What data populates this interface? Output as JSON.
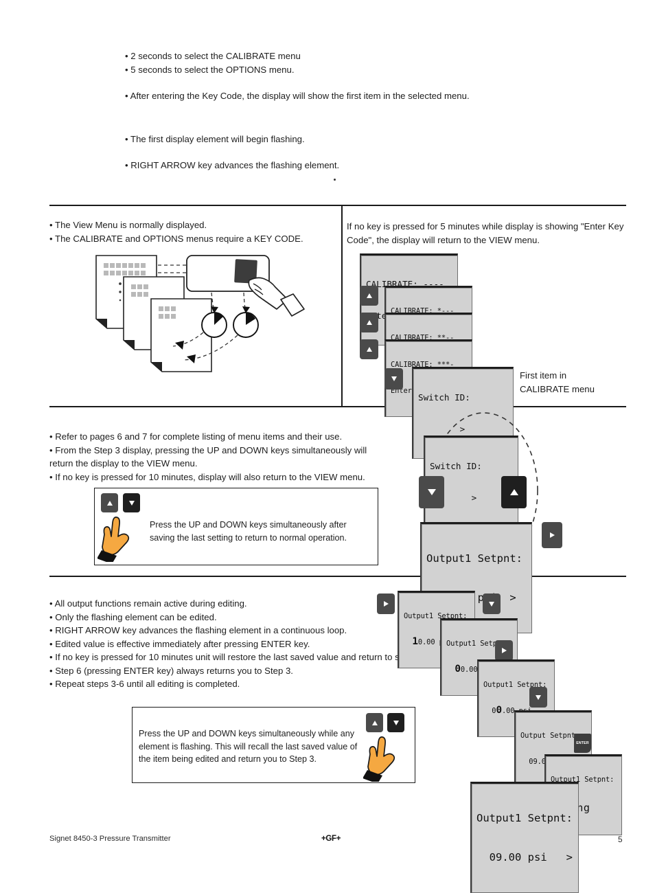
{
  "document": {
    "footer_left": "Signet 8450-3 Pressure Transmitter",
    "footer_brand": "+GF+",
    "page_number": "5"
  },
  "top_notes": {
    "group_a": [
      "2 seconds to select the CALIBRATE menu",
      "5 seconds to select the OPTIONS menu."
    ],
    "group_b": [
      "After entering the Key Code, the display will show the first item in the selected menu."
    ],
    "group_c": [
      "The first display element will begin flashing."
    ],
    "group_d": [
      "RIGHT ARROW key advances the flashing element."
    ]
  },
  "panel1": {
    "left_bullets": [
      "The View Menu is normally displayed.",
      "The CALIBRATE and OPTIONS menus require a KEY CODE."
    ],
    "right_text": "If no key is pressed for 5 minutes while display is showing \"Enter Key Code\", the display will return to the VIEW menu.",
    "first_item_caption_line1": "First item in",
    "first_item_caption_line2": "CALIBRATE menu",
    "displays": [
      {
        "line1": "CALIBRATE: ----",
        "line2": "Enter Key Code"
      },
      {
        "line1": "CALIBRATE: *---",
        "line2": "Enter Key Code"
      },
      {
        "line1": "CALIBRATE: **--",
        "line2": "Enter Key Code"
      },
      {
        "line1": "CALIBRATE: ***-",
        "line2": "Enter Key Code"
      },
      {
        "line1": "Switch ID:",
        "line2": "        >"
      }
    ],
    "keys": [
      {
        "glyph": "up-arrow"
      },
      {
        "glyph": "up-arrow"
      },
      {
        "glyph": "up-arrow"
      },
      {
        "glyph": "down-arrow"
      }
    ]
  },
  "panel2": {
    "bullets": [
      "Refer to pages 6 and 7 for complete listing of menu items and their use.",
      "From the Step 3 display, pressing the UP and DOWN keys simultaneously will return the display to the VIEW menu.",
      "If no key is pressed for 10 minutes, display will also return to the VIEW menu."
    ],
    "callout_text": "Press the UP and DOWN keys simultaneously after saving the last setting to return to normal operation.",
    "loop": {
      "top_display": {
        "line1": "Switch ID:",
        "line2": "        >"
      },
      "bottom_display": {
        "line1": "Output1 Setpnt:",
        "line2": "  10.00 psi  >"
      },
      "key_down": "down-arrow",
      "key_up": "up-arrow",
      "key_right": "right-arrow"
    }
  },
  "panel3": {
    "bullets": [
      "All output functions remain active during editing.",
      "Only the flashing element can be edited.",
      "RIGHT ARROW key advances the flashing element in a continuous loop.",
      "Edited value is effective immediately after pressing ENTER key.",
      "If no key is pressed for 10 minutes unit will restore the last saved value and return to step 3.",
      "Step 6 (pressing ENTER key) always returns you to Step 3.",
      "Repeat steps 3-6 until all editing is completed."
    ],
    "callout_text": "Press the UP and DOWN keys simultaneously while any element is flashing. This will recall the last saved value of the item being edited and return you to Step 3.",
    "sequence": [
      {
        "line1": "Output1 Setpnt:",
        "pre": "  ",
        "flash": "1",
        "post": "0.00 psi"
      },
      {
        "line1": "Output1 Setpnt:",
        "pre": "  ",
        "flash": "0",
        "post": "0.00 psi"
      },
      {
        "line1": "Output1 Setpnt:",
        "pre": "  0",
        "flash": "0",
        "post": ".00 psi"
      },
      {
        "line1": "Output Setpnt:",
        "pre": "  09.00 psi",
        "flash": "",
        "post": ""
      },
      {
        "line1": "Output1 Setpnt:",
        "pre": "",
        "flash": "",
        "post": "",
        "saving": "Saving"
      },
      {
        "line1": "Output1 Setpnt:",
        "pre": "",
        "flash": "",
        "post": "",
        "final": "  09.00 psi   >"
      }
    ],
    "keys": [
      {
        "glyph": "right-arrow"
      },
      {
        "glyph": "down-arrow"
      },
      {
        "glyph": "right-arrow"
      },
      {
        "glyph": "down-arrow"
      },
      {
        "glyph": "enter",
        "label": "ENTER"
      }
    ]
  },
  "colors": {
    "key_fill": "#4a4a4a",
    "key_fill_dark": "#1f1f1f",
    "lcd_bg": "#d2d2d2",
    "hand": "#f5a841",
    "rule": "#1a1a1a"
  }
}
